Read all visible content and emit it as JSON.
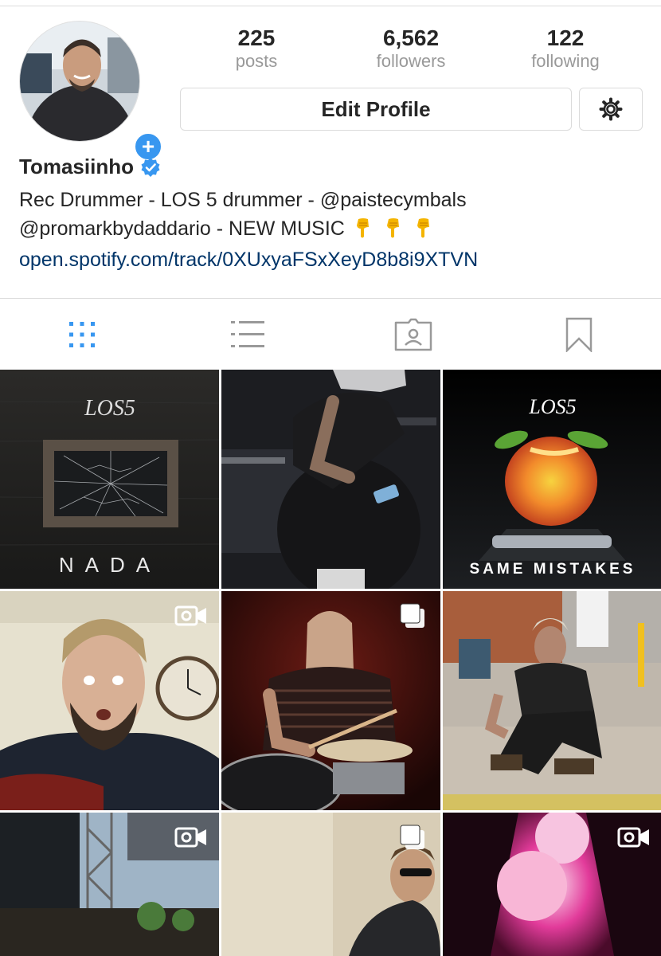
{
  "profile": {
    "username": "Tomasiinho",
    "bio_line1": "Rec Drummer - LOS 5 drummer - @paistecymbals",
    "bio_line2": "@promarkbydaddario - NEW MUSIC",
    "link": "open.spotify.com/track/0XUxyaFSxXeyD8b8i9XTVN",
    "verified": true,
    "bio_emoji": [
      "backhand-index-pointing-down",
      "backhand-index-pointing-down",
      "backhand-index-pointing-down"
    ]
  },
  "stats": {
    "posts_count": "225",
    "posts_label": "posts",
    "followers_count": "6,562",
    "followers_label": "followers",
    "following_count": "122",
    "following_label": "following"
  },
  "buttons": {
    "edit_profile": "Edit Profile"
  },
  "icons": {
    "settings": "gear-icon",
    "add_story": "plus-icon",
    "verified": "verified-badge-icon",
    "tabs": [
      "grid-icon",
      "list-icon",
      "tagged-icon",
      "bookmark-icon"
    ],
    "video": "video-camera-icon",
    "carousel": "multiple-photos-icon"
  },
  "colors": {
    "accent": "#3897f0",
    "link": "#003569",
    "muted": "#999999",
    "border": "#dbdbdb"
  },
  "posts": [
    {
      "kind": "image",
      "caption": "NADA",
      "logo": "LOS5"
    },
    {
      "kind": "image"
    },
    {
      "kind": "image",
      "caption": "SAME MISTAKES",
      "logo": "LOS5"
    },
    {
      "kind": "video"
    },
    {
      "kind": "carousel"
    },
    {
      "kind": "image"
    },
    {
      "kind": "video"
    },
    {
      "kind": "carousel"
    },
    {
      "kind": "video"
    }
  ]
}
